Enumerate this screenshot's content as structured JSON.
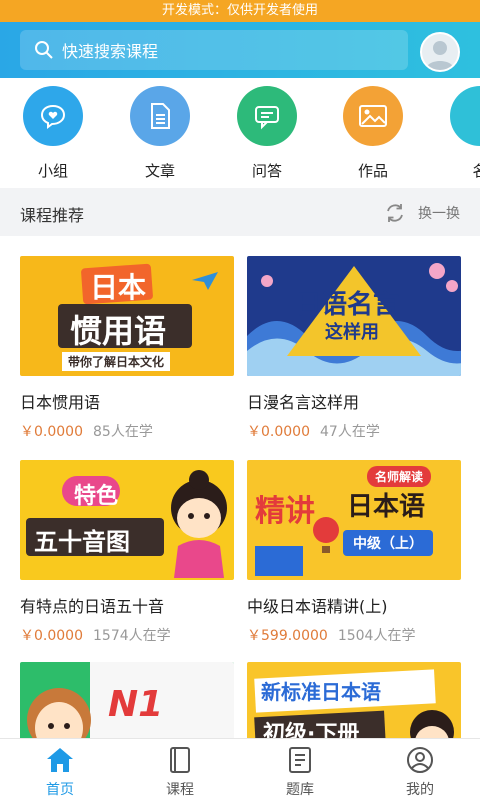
{
  "dev_banner": "开发模式：仅供开发者使用",
  "search": {
    "placeholder": "快速搜索课程"
  },
  "categories": [
    {
      "label": "小组",
      "color": "#2ea7ea",
      "icon": "chat-heart-icon"
    },
    {
      "label": "文章",
      "color": "#5aa6e8",
      "icon": "document-icon"
    },
    {
      "label": "问答",
      "color": "#2dba7a",
      "icon": "message-icon"
    },
    {
      "label": "作品",
      "color": "#f3a236",
      "icon": "image-icon"
    },
    {
      "label": "名",
      "color": "#2fc0d8",
      "icon": "partial-icon"
    }
  ],
  "section": {
    "title": "课程推荐",
    "switch_label": "换一换"
  },
  "courses": [
    {
      "title": "日本惯用语",
      "price": "￥0.0000",
      "learners": "85人在学",
      "banner_main": "日本",
      "banner_sub": "惯用语",
      "banner_tag": "带你了解日本文化"
    },
    {
      "title": "日漫名言这样用",
      "price": "￥0.0000",
      "learners": "47人在学",
      "banner_main": "日语名言",
      "banner_sub": "这样用"
    },
    {
      "title": "有特点的日语五十音",
      "price": "￥0.0000",
      "learners": "1574人在学",
      "banner_main": "特色",
      "banner_sub": "五十音图"
    },
    {
      "title": "中级日本语精讲(上)",
      "price": "￥599.0000",
      "learners": "1504人在学",
      "banner_main": "精讲",
      "banner_sub": "日本语",
      "banner_tag": "名师解读",
      "banner_level": "中级（上）"
    },
    {
      "title": "",
      "price": "",
      "learners": "",
      "banner_main": "N1"
    },
    {
      "title": "",
      "price": "",
      "learners": "",
      "banner_main": "新标准日本语",
      "banner_sub": "初级·下册"
    }
  ],
  "tabs": [
    {
      "label": "首页",
      "icon": "home-icon",
      "active": true
    },
    {
      "label": "课程",
      "icon": "book-icon",
      "active": false
    },
    {
      "label": "题库",
      "icon": "question-bank-icon",
      "active": false
    },
    {
      "label": "我的",
      "icon": "profile-icon",
      "active": false
    }
  ],
  "colors": {
    "accent": "#1f9ae6",
    "price": "#e07b39",
    "header": "#2aa7e6",
    "dev_banner": "#f5a623"
  }
}
